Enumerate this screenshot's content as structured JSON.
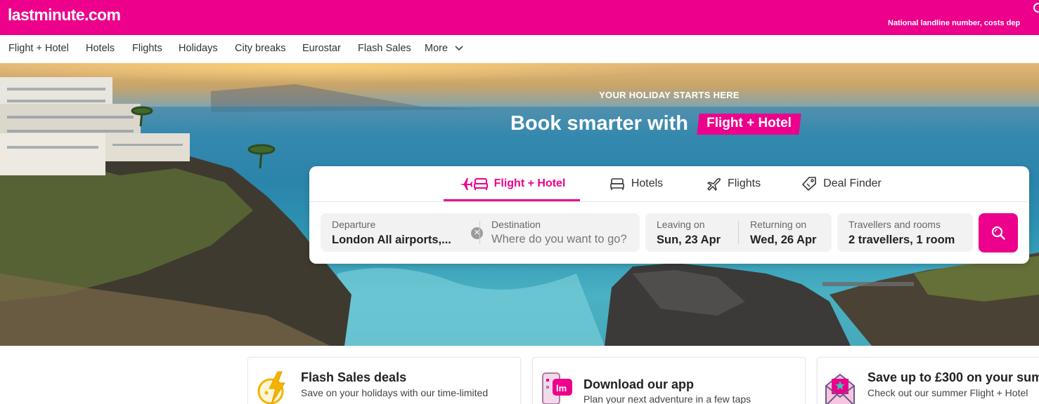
{
  "brand": {
    "logo_text": "lastminute.com",
    "accent_color": "#ec008c",
    "topbar_note": "National landline number, costs dep"
  },
  "nav": {
    "items": [
      {
        "label": "Flight + Hotel"
      },
      {
        "label": "Hotels"
      },
      {
        "label": "Flights"
      },
      {
        "label": "Holidays"
      },
      {
        "label": "City breaks"
      },
      {
        "label": "Eurostar"
      },
      {
        "label": "Flash Sales"
      },
      {
        "label": "More",
        "icon": "chevron-down-icon"
      }
    ]
  },
  "hero": {
    "kicker": "YOUR HOLIDAY STARTS HERE",
    "title": "Book smarter with",
    "highlight": "Flight + Hotel"
  },
  "search": {
    "tabs": [
      {
        "label": "Flight + Hotel",
        "icon": "plane-bed-icon",
        "active": true
      },
      {
        "label": "Hotels",
        "icon": "bed-icon",
        "active": false
      },
      {
        "label": "Flights",
        "icon": "plane-icon",
        "active": false
      },
      {
        "label": "Deal Finder",
        "icon": "tag-icon",
        "active": false
      }
    ],
    "departure": {
      "label": "Departure",
      "value": "London All airports,..."
    },
    "destination": {
      "label": "Destination",
      "placeholder": "Where do you want to go?",
      "value": ""
    },
    "leaving": {
      "label": "Leaving on",
      "value": "Sun, 23 Apr"
    },
    "returning": {
      "label": "Returning on",
      "value": "Wed, 26 Apr"
    },
    "travellers": {
      "label": "Travellers and rooms",
      "value": "2 travellers, 1 room"
    },
    "search_button_icon": "search-icon"
  },
  "promos": [
    {
      "title": "Flash Sales deals",
      "desc": "Save on your holidays with our time-limited",
      "icon": "lightning-clock-icon"
    },
    {
      "title": "Download our app",
      "desc": "Plan your next adventure in a few taps",
      "icon": "phone-app-icon"
    },
    {
      "title": "Save up to £300 on your sum",
      "desc": "Check out our summer Flight + Hotel",
      "icon": "envelope-icon"
    }
  ]
}
